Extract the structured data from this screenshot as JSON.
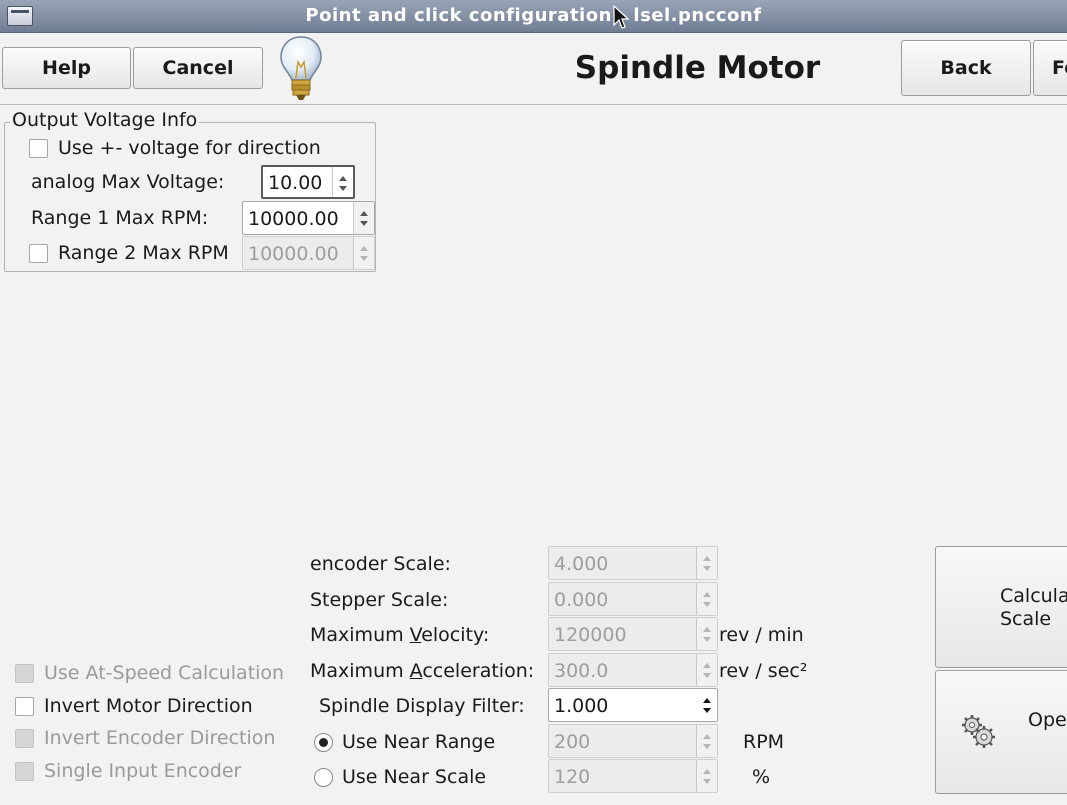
{
  "window": {
    "title": "Point and click configuration - lsel.pncconf",
    "window_menu_icon": "window-menu-icon",
    "cursor_icon": "mouse-pointer-icon"
  },
  "header": {
    "help_label": "Help",
    "cancel_label": "Cancel",
    "hint_icon": "lightbulb-icon",
    "title": "Spindle Motor",
    "back_label": "Back",
    "forward_label": "Fo"
  },
  "output_voltage": {
    "legend": "Output Voltage Info",
    "use_pm_voltage_label": "Use +- voltage for direction",
    "use_pm_voltage_checked": false,
    "analog_max_voltage_label": "analog Max Voltage:",
    "analog_max_voltage_value": "10.00",
    "range1_label": "Range 1 Max RPM:",
    "range1_value": "10000.00",
    "range2_label": "Range 2 Max RPM",
    "range2_value": "10000.00",
    "range2_checked": false
  },
  "encoder": {
    "encoder_scale_label": "encoder Scale:",
    "encoder_scale_value": "4.000",
    "stepper_scale_label": "Stepper Scale:",
    "stepper_scale_value": "0.000",
    "max_velocity_label_pre": "Maximum ",
    "max_velocity_label_u": "V",
    "max_velocity_label_post": "elocity:",
    "max_velocity_value": "120000",
    "max_velocity_unit": "rev / min",
    "max_accel_label_pre": "Maximum ",
    "max_accel_label_u": "A",
    "max_accel_label_post": "cceleration:",
    "max_accel_value": "300.0",
    "max_accel_unit": "rev / sec²",
    "display_filter_label": "Spindle Display Filter:",
    "display_filter_value": "1.000",
    "near_range_label": "Use Near Range",
    "near_range_value": "200",
    "near_range_unit": "RPM",
    "near_range_selected": true,
    "near_scale_label": "Use Near Scale",
    "near_scale_value": "120",
    "near_scale_unit": "%"
  },
  "options": {
    "at_speed_label": "Use At-Speed Calculation",
    "invert_motor_label": "Invert Motor Direction",
    "invert_encoder_label": "Invert Encoder Direction",
    "single_input_label": "Single Input Encoder"
  },
  "side": {
    "calc_scale_line1": "Calcula",
    "calc_scale_line2": "Scale",
    "open_label": "Ope",
    "open_icon": "gears-icon"
  }
}
